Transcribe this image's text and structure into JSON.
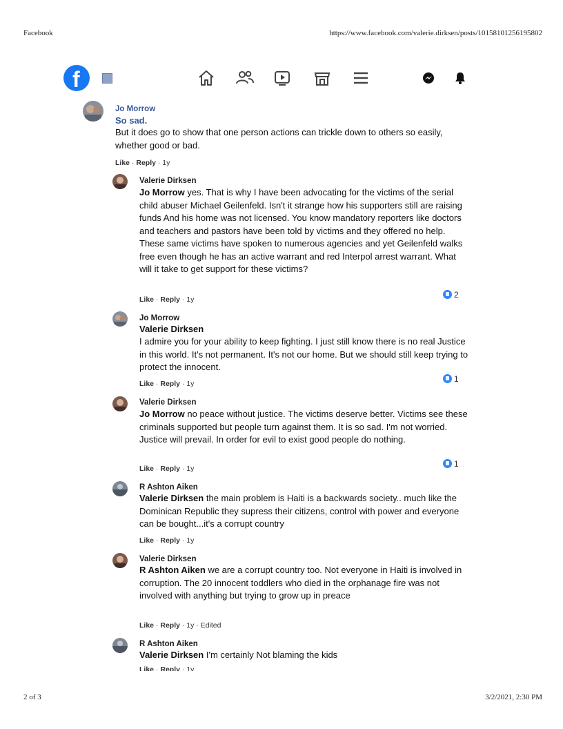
{
  "print": {
    "header_left": "Facebook",
    "header_right": "https://www.facebook.com/valerie.dirksen/posts/10158101256195802",
    "footer_left": "2 of 3",
    "footer_right": "3/2/2021, 2:30 PM"
  },
  "nav": {
    "icons": [
      "facebook-logo",
      "menu-icon",
      "home-icon",
      "friends-icon",
      "watch-icon",
      "marketplace-icon",
      "menu-lines-icon",
      "messenger-icon",
      "notifications-icon"
    ]
  },
  "comments": [
    {
      "author": "Jo Morrow",
      "lead": "So sad.",
      "text": "But it does go to show that one person actions can trickle down to others so easily, whether good or bad.",
      "meta_like": "Like",
      "meta_reply": "Reply",
      "meta_rest": " · 1y"
    },
    {
      "author": "Valerie Dirksen",
      "mention": "Jo Morrow",
      "text": " yes. That is why I have been advocating for the victims of the serial child abuser Michael Geilenfeld. Isn't it strange how his supporters still are raising funds And his home was not licensed. You know mandatory reporters like doctors and teachers and pastors have been told by victims and they offered no help. These same victims have spoken to numerous agencies and yet Geilenfeld walks free even though he has an active warrant and red Interpol arrest warrant. What will it take to get support for these victims?",
      "meta_like": "Like",
      "meta_reply": "Reply",
      "meta_rest": " · 1y",
      "reactions": "2"
    },
    {
      "author": "Jo Morrow",
      "mention_line": "Valerie Dirksen",
      "text": "I admire you for your ability to keep fighting. I just still know there is no real Justice in this world. It's not permanent. It's not our home. But we should still keep trying to protect the innocent.",
      "meta_like": "Like",
      "meta_reply": "Reply",
      "meta_rest": " · 1y",
      "reactions": "1"
    },
    {
      "author": "Valerie Dirksen",
      "mention": "Jo Morrow",
      "text": " no peace without justice. The victims deserve better. Victims see these criminals supported but people turn against them. It is so sad. I'm not worried. Justice will prevail. In order for evil to exist good people do nothing.",
      "meta_like": "Like",
      "meta_reply": "Reply",
      "meta_rest": " · 1y",
      "reactions": "1"
    },
    {
      "author": "R Ashton Aiken",
      "mention": "Valerie Dirksen",
      "text": " the main problem is Haiti is a backwards society.. much like the Dominican Republic they supress their citizens, control with power and everyone can be bought...it's a corrupt country",
      "meta_like": "Like",
      "meta_reply": "Reply",
      "meta_rest": " · 1y"
    },
    {
      "author": "Valerie Dirksen",
      "mention": "R Ashton Aiken",
      "text": " we are a corrupt country too. Not everyone in Haiti is involved in corruption. The 20 innocent toddlers who died in the orphanage fire was not involved with anything but trying to grow up in preace",
      "meta_like": "Like",
      "meta_reply": "Reply",
      "meta_rest": " · 1y · Edited"
    },
    {
      "author": "R Ashton Aiken",
      "mention": "Valerie Dirksen",
      "text": " I'm certainly Not blaming the kids",
      "meta_like": "Like",
      "meta_reply": "Reply",
      "meta_rest": " · 1y"
    }
  ],
  "colors": {
    "brand": "#1877f2",
    "reaction": "#2d88ff",
    "author_link": "#385898"
  }
}
